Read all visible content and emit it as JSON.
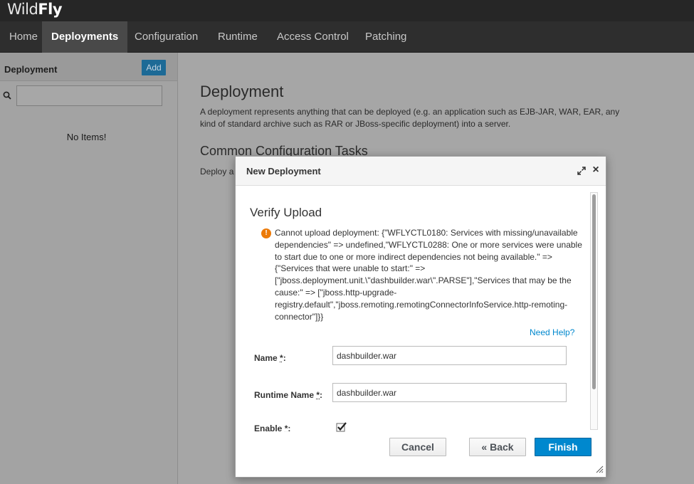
{
  "brand": {
    "light": "Wild",
    "bold": "Fly"
  },
  "nav": {
    "items": [
      {
        "label": "Home",
        "active": false
      },
      {
        "label": "Deployments",
        "active": true
      },
      {
        "label": "Configuration",
        "active": false
      },
      {
        "label": "Runtime",
        "active": false
      },
      {
        "label": "Access Control",
        "active": false
      },
      {
        "label": "Patching",
        "active": false
      }
    ]
  },
  "sidebar": {
    "title": "Deployment",
    "add_label": "Add",
    "search_value": "",
    "empty_text": "No Items!",
    "search_icon": "search-icon"
  },
  "main": {
    "title": "Deployment",
    "description": "A deployment represents anything that can be deployed (e.g. an application such as EJB-JAR, WAR, EAR, any kind of standard archive such as RAR or JBoss-specific deployment) into a server.",
    "tasks_title": "Common Configuration Tasks",
    "tasks_desc": "Deploy a"
  },
  "modal": {
    "title": "New Deployment",
    "expand_icon": "expand-icon",
    "close_icon": "close-icon",
    "close_glyph": "×",
    "verify_title": "Verify Upload",
    "warn_icon": "exclamation-circle-icon",
    "warn_glyph": "!",
    "error_text": "Cannot upload deployment: {\"WFLYCTL0180: Services with missing/unavailable dependencies\" => undefined,\"WFLYCTL0288: One or more services were unable to start due to one or more indirect dependencies not being available.\" => {\"Services that were unable to start:\" => [\"jboss.deployment.unit.\\\"dashbuilder.war\\\".PARSE\"],\"Services that may be the cause:\" => [\"jboss.http-upgrade-registry.default\",\"jboss.remoting.remotingConnectorInfoService.http-remoting-connector\"]}}",
    "help_link": "Need Help?",
    "fields": {
      "name_label": "Name",
      "name_value": "dashbuilder.war",
      "runtime_label": "Runtime Name",
      "runtime_value": "dashbuilder.war",
      "enable_label": "Enable",
      "enable_checked": true,
      "required_mark": "*",
      "colon": ":"
    },
    "buttons": {
      "cancel": "Cancel",
      "back": "« Back",
      "finish": "Finish"
    }
  },
  "colors": {
    "primary": "#0088ce",
    "warning": "#ec7a08",
    "nav_bg": "#2e2e2e",
    "brand_bg": "#262626"
  }
}
